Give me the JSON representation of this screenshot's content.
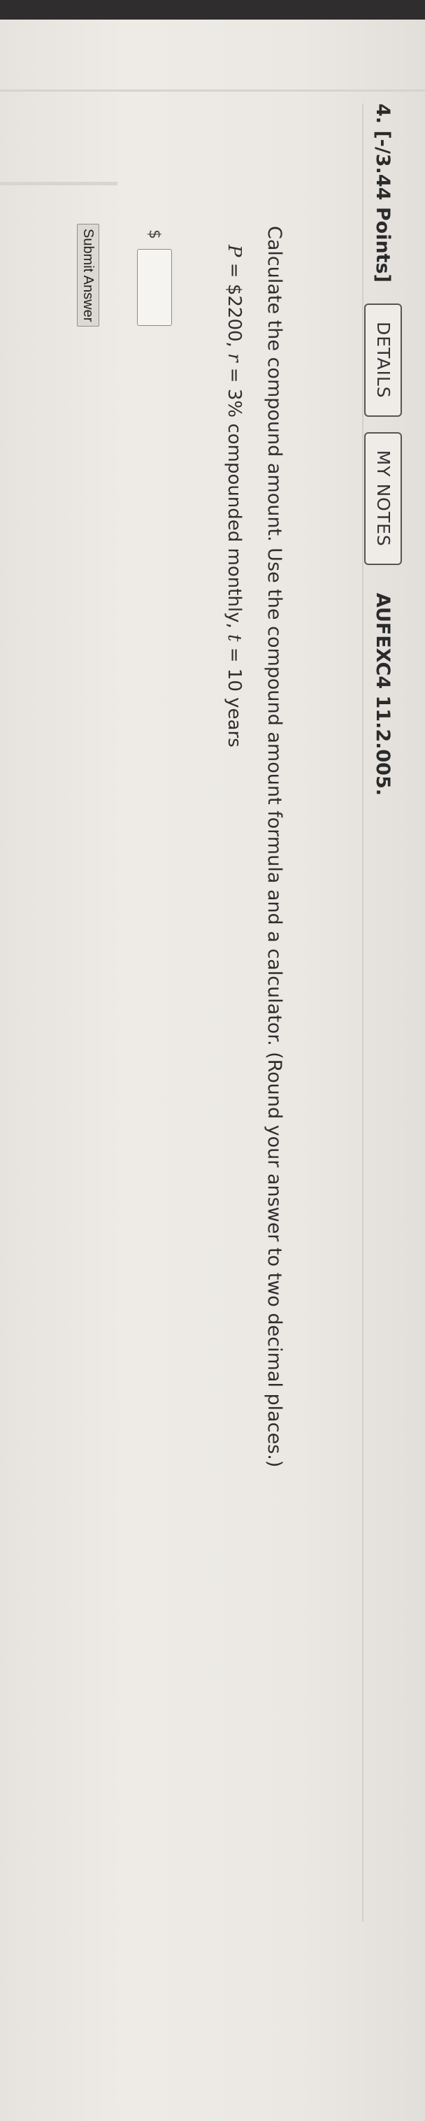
{
  "question": {
    "number_points": "4. [-/3.44 Points]",
    "details_label": "DETAILS",
    "my_notes_label": "MY NOTES",
    "code": "AUFEXC4 11.2.005.",
    "instructions": "Calculate the compound amount. Use the compound amount formula and a calculator. (Round your answer to two decimal places.)",
    "formula": {
      "p_var": "P",
      "p_value": " = $2200, ",
      "r_var": "r",
      "r_value": " = 3% compounded monthly, ",
      "t_var": "t",
      "t_value": " = 10 years"
    },
    "answer_prefix": "$",
    "answer_value": "",
    "submit_label": "Submit Answer"
  },
  "colors": {
    "background": "#ebe8e4",
    "text": "#2c2c2c",
    "button_border": "#555555",
    "top_bar": "#2f2d2d"
  }
}
